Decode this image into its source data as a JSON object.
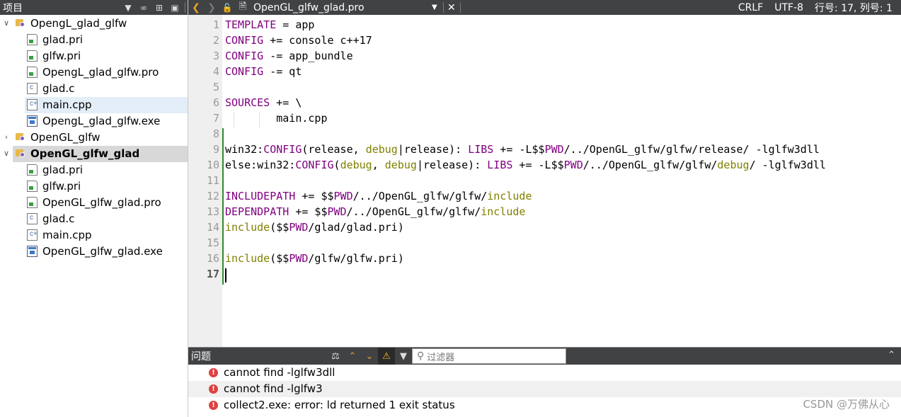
{
  "project_panel": {
    "title": "项目",
    "tree": [
      {
        "label": "OpengL_glad_glfw",
        "kind": "project",
        "expanded": true
      },
      {
        "label": "glad.pri",
        "kind": "pri"
      },
      {
        "label": "glfw.pri",
        "kind": "pri"
      },
      {
        "label": "OpengL_glad_glfw.pro",
        "kind": "pro"
      },
      {
        "label": "glad.c",
        "kind": "c"
      },
      {
        "label": "main.cpp",
        "kind": "cpp",
        "selected": true
      },
      {
        "label": "OpengL_glad_glfw.exe",
        "kind": "exe"
      },
      {
        "label": "OpenGL_glfw",
        "kind": "project",
        "expanded": false
      },
      {
        "label": "OpenGL_glfw_glad",
        "kind": "project",
        "expanded": true,
        "current": true
      },
      {
        "label": "glad.pri",
        "kind": "pri"
      },
      {
        "label": "glfw.pri",
        "kind": "pri"
      },
      {
        "label": "OpenGL_glfw_glad.pro",
        "kind": "pro"
      },
      {
        "label": "glad.c",
        "kind": "c"
      },
      {
        "label": "main.cpp",
        "kind": "cpp"
      },
      {
        "label": "OpenGL_glfw_glad.exe",
        "kind": "exe"
      }
    ]
  },
  "editor": {
    "file_name": "OpenGL_glfw_glad.pro",
    "line_ending": "CRLF",
    "encoding": "UTF-8",
    "cursor_position": "行号: 17, 列号: 1",
    "current_line": 17,
    "lines": [
      "TEMPLATE = app",
      "CONFIG += console c++17",
      "CONFIG -= app_bundle",
      "CONFIG -= qt",
      "",
      "SOURCES += \\",
      "        main.cpp",
      "",
      "win32:CONFIG(release, debug|release): LIBS += -L$$PWD/../OpenGL_glfw/glfw/release/ -lglfw3dll",
      "else:win32:CONFIG(debug, debug|release): LIBS += -L$$PWD/../OpenGL_glfw/glfw/debug/ -lglfw3dll",
      "",
      "INCLUDEPATH += $$PWD/../OpenGL_glfw/glfw/include",
      "DEPENDPATH += $$PWD/../OpenGL_glfw/glfw/include",
      "include($$PWD/glad/glad.pri)",
      "",
      "include($$PWD/glfw/glfw.pri)",
      ""
    ]
  },
  "issues_panel": {
    "title": "问题",
    "filter_placeholder": "过滤器",
    "issues": [
      "cannot find -lglfw3dll",
      "cannot find -lglfw3",
      "collect2.exe: error: ld returned 1 exit status"
    ]
  },
  "watermark": "CSDN @万佛从心"
}
